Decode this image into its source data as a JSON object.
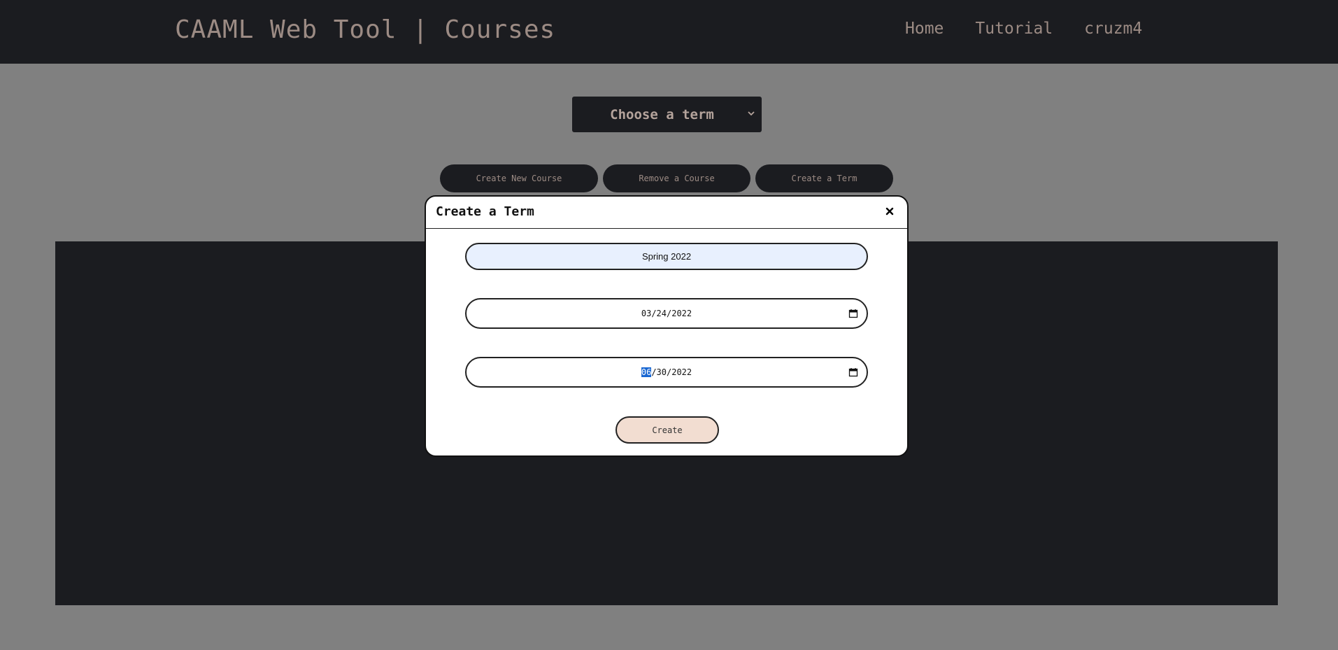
{
  "header": {
    "brand": "CAAML Web Tool | Courses",
    "nav": [
      "Home",
      "Tutorial",
      "cruzm4"
    ]
  },
  "term_select": {
    "selected": "Choose a term",
    "icon": "chevron-down-icon"
  },
  "actions": {
    "create_course": "Create New Course",
    "remove_course": "Remove a Course",
    "create_term": "Create a Term"
  },
  "modal": {
    "title": "Create a Term",
    "close_icon": "close-icon",
    "term_name": "Spring 2022",
    "start_date": {
      "month": "03",
      "day": "24",
      "year": "2022"
    },
    "end_date": {
      "month": "06",
      "day": "30",
      "year": "2022"
    },
    "calendar_icon": "calendar-icon",
    "submit": "Create"
  },
  "colors": {
    "header_bg": "#1b1c20",
    "accent_text": "#9c8b84",
    "overlay": "#808080",
    "submit_bg": "#f2ddd1",
    "autofill_bg": "#e8f0fe",
    "selection": "#1967d2"
  }
}
